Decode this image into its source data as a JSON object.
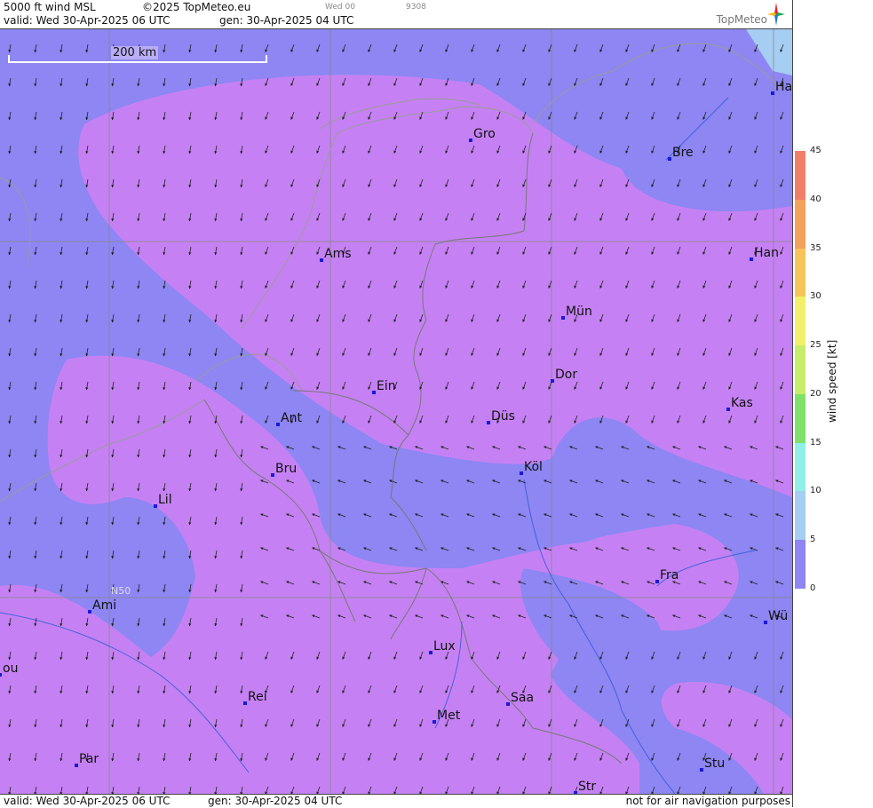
{
  "header": {
    "product": "5000 ft wind MSL",
    "copyright": "©2025 TopMeteo.eu",
    "tiny_day": "Wed 00",
    "tiny_code": "9308",
    "valid": "valid:  Wed  30-Apr-2025  06 UTC",
    "gen": "gen: 30-Apr-2025 04 UTC",
    "logo": "TopMeteo"
  },
  "footer": {
    "valid": "valid:  Wed  30-Apr-2025  06 UTC",
    "gen": "gen: 30-Apr-2025 04 UTC",
    "disclaimer": "not for air navigation purposes"
  },
  "scale": {
    "label": "200 km"
  },
  "grid_label": "N50",
  "colorbar": {
    "title": "wind  speed  [kt]",
    "ticks": [
      "45",
      "40",
      "35",
      "30",
      "25",
      "20",
      "15",
      "10",
      "5",
      "0"
    ],
    "colors": [
      "#f07f6a",
      "#f4a15c",
      "#f8c45a",
      "#f2f06a",
      "#c6ee6a",
      "#7fe06a",
      "#8ff0e8",
      "#a6cdf2",
      "#8d86f3",
      "#c581f3"
    ]
  },
  "cities": [
    {
      "name": "Gro"
    },
    {
      "name": "Bre"
    },
    {
      "name": "Ha"
    },
    {
      "name": "Ams"
    },
    {
      "name": "Han"
    },
    {
      "name": "Mün"
    },
    {
      "name": "Dor"
    },
    {
      "name": "Ein"
    },
    {
      "name": "Ant"
    },
    {
      "name": "Düs"
    },
    {
      "name": "Kas"
    },
    {
      "name": "Bru"
    },
    {
      "name": "Köl"
    },
    {
      "name": "Lil"
    },
    {
      "name": "Fra"
    },
    {
      "name": "Ami"
    },
    {
      "name": "Wü"
    },
    {
      "name": "Lux"
    },
    {
      "name": "ou"
    },
    {
      "name": "Rei"
    },
    {
      "name": "Saa"
    },
    {
      "name": "Met"
    },
    {
      "name": "Par"
    },
    {
      "name": "Stu"
    },
    {
      "name": "Str"
    }
  ]
}
